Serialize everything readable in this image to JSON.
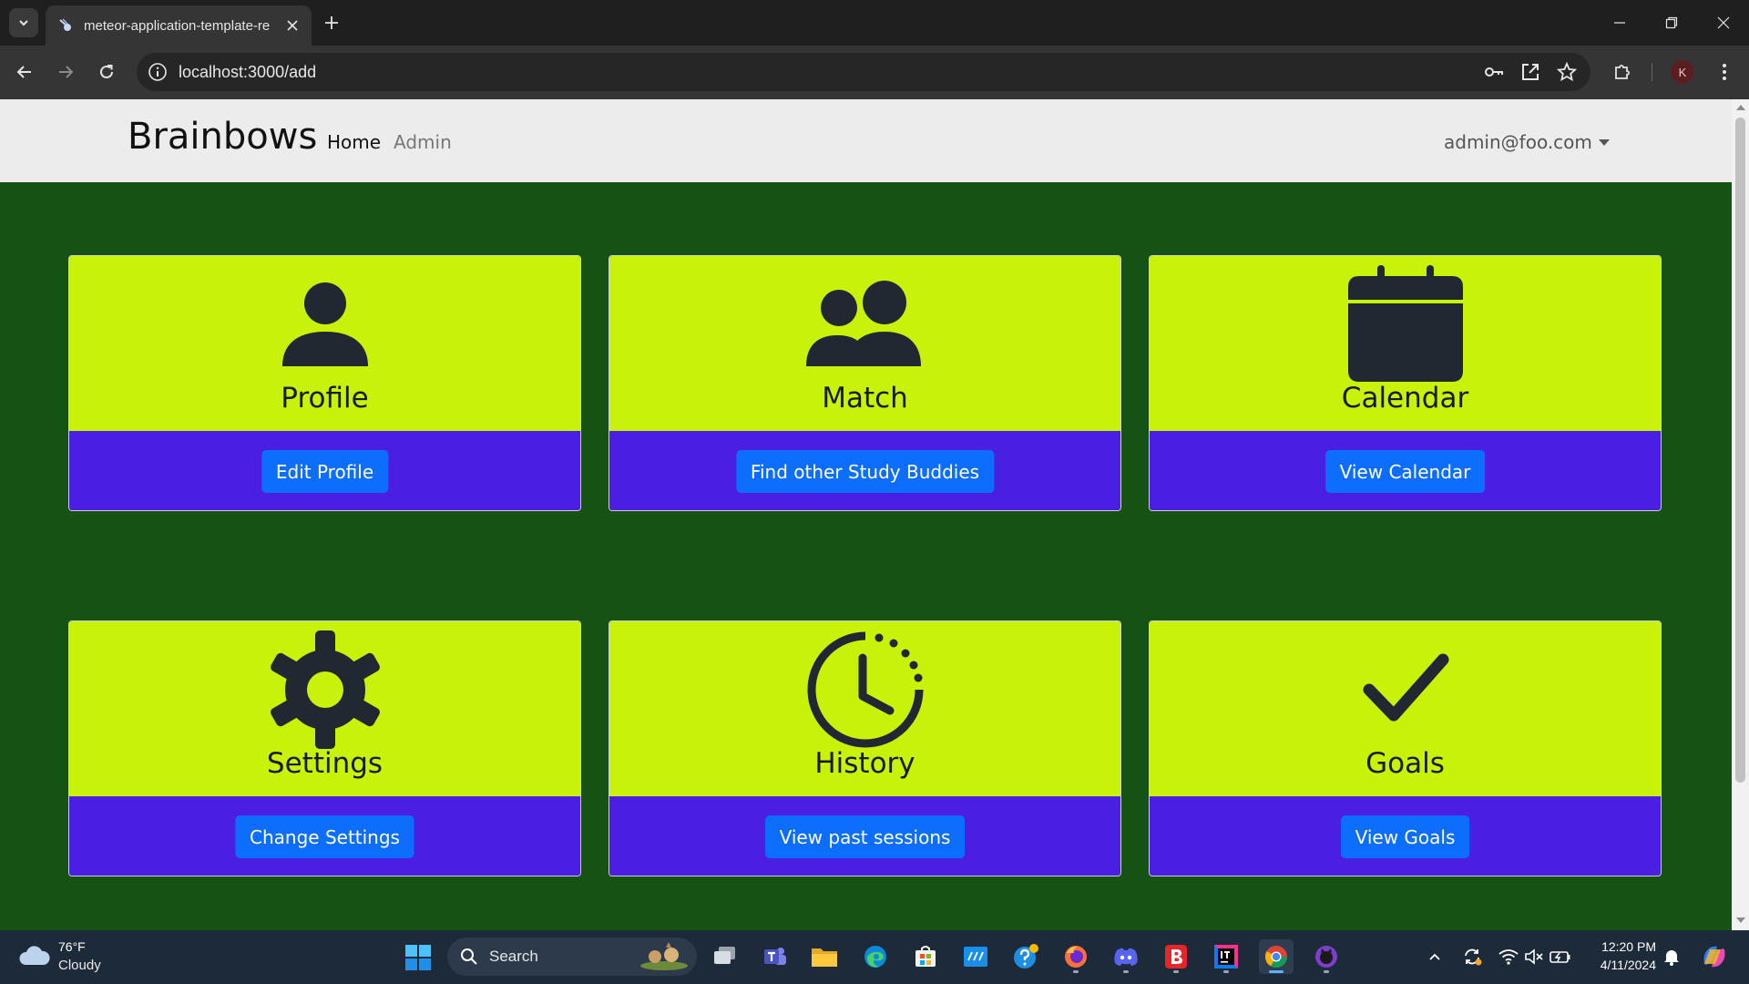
{
  "browser": {
    "tab_title": "meteor-application-template-re",
    "url": "localhost:3000/add",
    "profile_initial": "K"
  },
  "navbar": {
    "brand": "Brainbows",
    "links": [
      "Home",
      "Admin"
    ],
    "user": "admin@foo.com"
  },
  "cards": [
    {
      "title": "Profile",
      "icon": "person-icon",
      "button": "Edit Profile"
    },
    {
      "title": "Match",
      "icon": "people-icon",
      "button": "Find other Study Buddies"
    },
    {
      "title": "Calendar",
      "icon": "calendar-icon",
      "button": "View Calendar"
    },
    {
      "title": "Settings",
      "icon": "gear-icon",
      "button": "Change Settings"
    },
    {
      "title": "History",
      "icon": "clock-history-icon",
      "button": "View past sessions"
    },
    {
      "title": "Goals",
      "icon": "checkmark-icon",
      "button": "View Goals"
    }
  ],
  "colors": {
    "page_background": "#165214",
    "card_top": "#c8f20a",
    "card_bottom": "#4a1ee3",
    "button": "#0d6efd",
    "navbar": "#ececec"
  },
  "taskbar": {
    "weather_temp": "76°F",
    "weather_desc": "Cloudy",
    "search_label": "Search",
    "time": "12:20 PM",
    "date": "4/11/2024"
  }
}
